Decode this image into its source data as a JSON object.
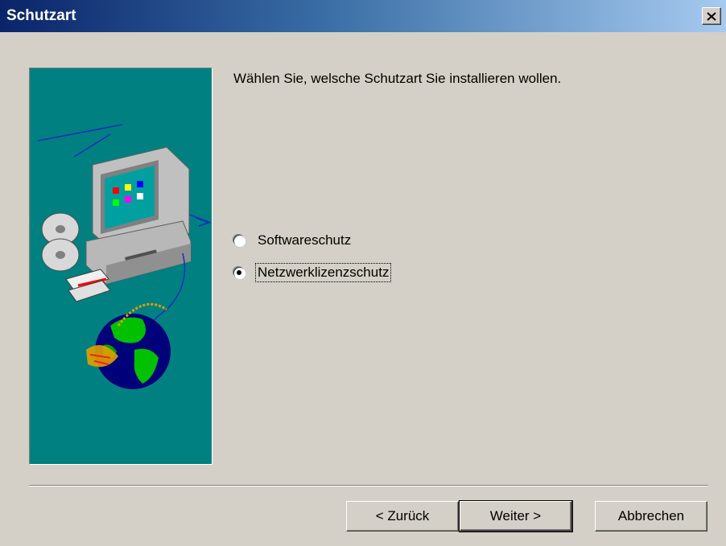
{
  "window": {
    "title": "Schutzart",
    "close_icon": "close-icon"
  },
  "prompt": "Wählen Sie, welsche Schutzart Sie installieren wollen.",
  "options": [
    {
      "label": "Softwareschutz",
      "selected": false
    },
    {
      "label": "Netzwerklizenzschutz",
      "selected": true
    }
  ],
  "buttons": {
    "back": "< Zurück",
    "next": "Weiter >",
    "cancel": "Abbrechen"
  },
  "colors": {
    "title_active": "#0a246a",
    "art_bg": "#008080",
    "face": "#d4d0c8"
  }
}
